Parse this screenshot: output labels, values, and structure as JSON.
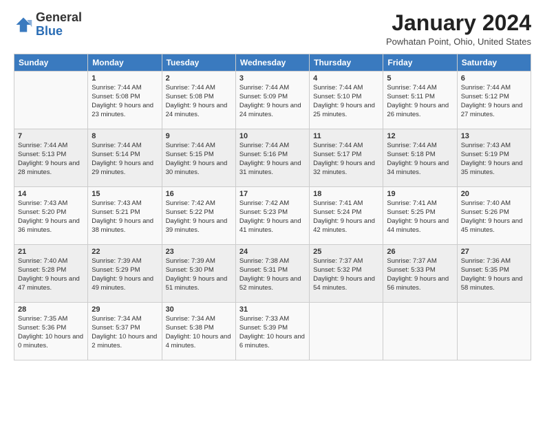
{
  "header": {
    "logo_general": "General",
    "logo_blue": "Blue",
    "month_title": "January 2024",
    "subtitle": "Powhatan Point, Ohio, United States"
  },
  "days_of_week": [
    "Sunday",
    "Monday",
    "Tuesday",
    "Wednesday",
    "Thursday",
    "Friday",
    "Saturday"
  ],
  "weeks": [
    [
      {
        "day": "",
        "sunrise": "",
        "sunset": "",
        "daylight": ""
      },
      {
        "day": "1",
        "sunrise": "Sunrise: 7:44 AM",
        "sunset": "Sunset: 5:08 PM",
        "daylight": "Daylight: 9 hours and 23 minutes."
      },
      {
        "day": "2",
        "sunrise": "Sunrise: 7:44 AM",
        "sunset": "Sunset: 5:08 PM",
        "daylight": "Daylight: 9 hours and 24 minutes."
      },
      {
        "day": "3",
        "sunrise": "Sunrise: 7:44 AM",
        "sunset": "Sunset: 5:09 PM",
        "daylight": "Daylight: 9 hours and 24 minutes."
      },
      {
        "day": "4",
        "sunrise": "Sunrise: 7:44 AM",
        "sunset": "Sunset: 5:10 PM",
        "daylight": "Daylight: 9 hours and 25 minutes."
      },
      {
        "day": "5",
        "sunrise": "Sunrise: 7:44 AM",
        "sunset": "Sunset: 5:11 PM",
        "daylight": "Daylight: 9 hours and 26 minutes."
      },
      {
        "day": "6",
        "sunrise": "Sunrise: 7:44 AM",
        "sunset": "Sunset: 5:12 PM",
        "daylight": "Daylight: 9 hours and 27 minutes."
      }
    ],
    [
      {
        "day": "7",
        "sunrise": "Sunrise: 7:44 AM",
        "sunset": "Sunset: 5:13 PM",
        "daylight": "Daylight: 9 hours and 28 minutes."
      },
      {
        "day": "8",
        "sunrise": "Sunrise: 7:44 AM",
        "sunset": "Sunset: 5:14 PM",
        "daylight": "Daylight: 9 hours and 29 minutes."
      },
      {
        "day": "9",
        "sunrise": "Sunrise: 7:44 AM",
        "sunset": "Sunset: 5:15 PM",
        "daylight": "Daylight: 9 hours and 30 minutes."
      },
      {
        "day": "10",
        "sunrise": "Sunrise: 7:44 AM",
        "sunset": "Sunset: 5:16 PM",
        "daylight": "Daylight: 9 hours and 31 minutes."
      },
      {
        "day": "11",
        "sunrise": "Sunrise: 7:44 AM",
        "sunset": "Sunset: 5:17 PM",
        "daylight": "Daylight: 9 hours and 32 minutes."
      },
      {
        "day": "12",
        "sunrise": "Sunrise: 7:44 AM",
        "sunset": "Sunset: 5:18 PM",
        "daylight": "Daylight: 9 hours and 34 minutes."
      },
      {
        "day": "13",
        "sunrise": "Sunrise: 7:43 AM",
        "sunset": "Sunset: 5:19 PM",
        "daylight": "Daylight: 9 hours and 35 minutes."
      }
    ],
    [
      {
        "day": "14",
        "sunrise": "Sunrise: 7:43 AM",
        "sunset": "Sunset: 5:20 PM",
        "daylight": "Daylight: 9 hours and 36 minutes."
      },
      {
        "day": "15",
        "sunrise": "Sunrise: 7:43 AM",
        "sunset": "Sunset: 5:21 PM",
        "daylight": "Daylight: 9 hours and 38 minutes."
      },
      {
        "day": "16",
        "sunrise": "Sunrise: 7:42 AM",
        "sunset": "Sunset: 5:22 PM",
        "daylight": "Daylight: 9 hours and 39 minutes."
      },
      {
        "day": "17",
        "sunrise": "Sunrise: 7:42 AM",
        "sunset": "Sunset: 5:23 PM",
        "daylight": "Daylight: 9 hours and 41 minutes."
      },
      {
        "day": "18",
        "sunrise": "Sunrise: 7:41 AM",
        "sunset": "Sunset: 5:24 PM",
        "daylight": "Daylight: 9 hours and 42 minutes."
      },
      {
        "day": "19",
        "sunrise": "Sunrise: 7:41 AM",
        "sunset": "Sunset: 5:25 PM",
        "daylight": "Daylight: 9 hours and 44 minutes."
      },
      {
        "day": "20",
        "sunrise": "Sunrise: 7:40 AM",
        "sunset": "Sunset: 5:26 PM",
        "daylight": "Daylight: 9 hours and 45 minutes."
      }
    ],
    [
      {
        "day": "21",
        "sunrise": "Sunrise: 7:40 AM",
        "sunset": "Sunset: 5:28 PM",
        "daylight": "Daylight: 9 hours and 47 minutes."
      },
      {
        "day": "22",
        "sunrise": "Sunrise: 7:39 AM",
        "sunset": "Sunset: 5:29 PM",
        "daylight": "Daylight: 9 hours and 49 minutes."
      },
      {
        "day": "23",
        "sunrise": "Sunrise: 7:39 AM",
        "sunset": "Sunset: 5:30 PM",
        "daylight": "Daylight: 9 hours and 51 minutes."
      },
      {
        "day": "24",
        "sunrise": "Sunrise: 7:38 AM",
        "sunset": "Sunset: 5:31 PM",
        "daylight": "Daylight: 9 hours and 52 minutes."
      },
      {
        "day": "25",
        "sunrise": "Sunrise: 7:37 AM",
        "sunset": "Sunset: 5:32 PM",
        "daylight": "Daylight: 9 hours and 54 minutes."
      },
      {
        "day": "26",
        "sunrise": "Sunrise: 7:37 AM",
        "sunset": "Sunset: 5:33 PM",
        "daylight": "Daylight: 9 hours and 56 minutes."
      },
      {
        "day": "27",
        "sunrise": "Sunrise: 7:36 AM",
        "sunset": "Sunset: 5:35 PM",
        "daylight": "Daylight: 9 hours and 58 minutes."
      }
    ],
    [
      {
        "day": "28",
        "sunrise": "Sunrise: 7:35 AM",
        "sunset": "Sunset: 5:36 PM",
        "daylight": "Daylight: 10 hours and 0 minutes."
      },
      {
        "day": "29",
        "sunrise": "Sunrise: 7:34 AM",
        "sunset": "Sunset: 5:37 PM",
        "daylight": "Daylight: 10 hours and 2 minutes."
      },
      {
        "day": "30",
        "sunrise": "Sunrise: 7:34 AM",
        "sunset": "Sunset: 5:38 PM",
        "daylight": "Daylight: 10 hours and 4 minutes."
      },
      {
        "day": "31",
        "sunrise": "Sunrise: 7:33 AM",
        "sunset": "Sunset: 5:39 PM",
        "daylight": "Daylight: 10 hours and 6 minutes."
      },
      {
        "day": "",
        "sunrise": "",
        "sunset": "",
        "daylight": ""
      },
      {
        "day": "",
        "sunrise": "",
        "sunset": "",
        "daylight": ""
      },
      {
        "day": "",
        "sunrise": "",
        "sunset": "",
        "daylight": ""
      }
    ]
  ]
}
